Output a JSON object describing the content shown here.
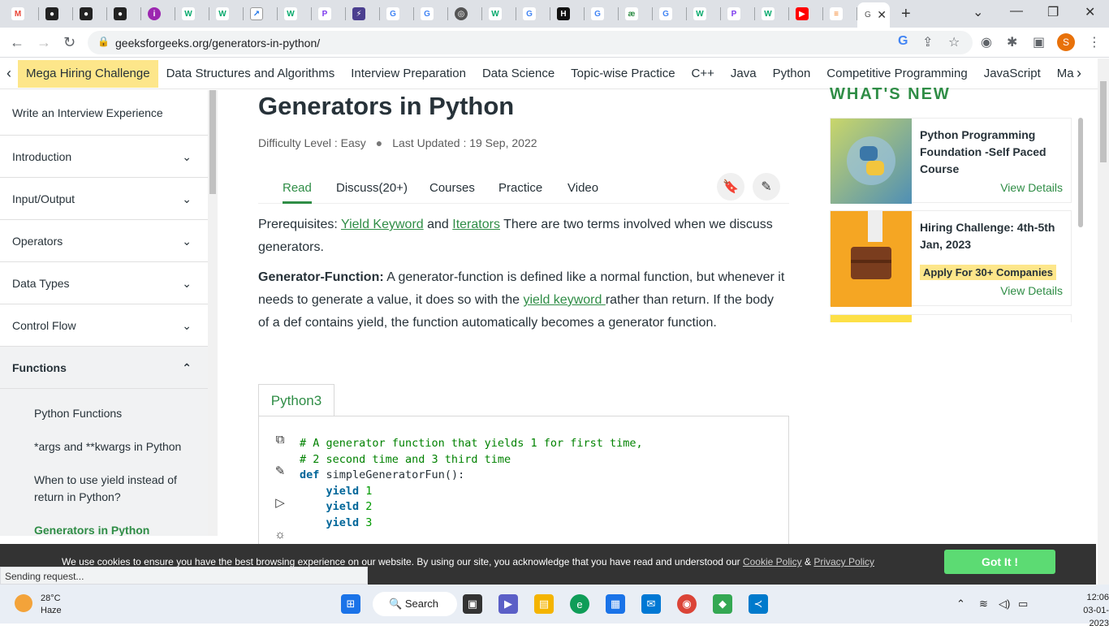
{
  "browser": {
    "active_tab_label": "G",
    "url": "geeksforgeeks.org/generators-in-python/",
    "profile_initial": "S"
  },
  "sitenav": {
    "items": [
      "Mega Hiring Challenge",
      "Data Structures and Algorithms",
      "Interview Preparation",
      "Data Science",
      "Topic-wise Practice",
      "C++",
      "Java",
      "Python",
      "Competitive Programming",
      "JavaScript",
      "Ma"
    ]
  },
  "sidebar": {
    "top_link": "Write an Interview Experience",
    "sections": [
      "Introduction",
      "Input/Output",
      "Operators",
      "Data Types",
      "Control Flow",
      "Functions"
    ],
    "sub_items": [
      "Python Functions",
      "*args and **kwargs in Python",
      "When to use yield instead of return in Python?",
      "Generators in Python"
    ]
  },
  "article": {
    "title": "Generators in Python",
    "difficulty": "Difficulty Level : Easy",
    "updated": "Last Updated : 19 Sep, 2022",
    "tabs": [
      "Read",
      "Discuss(20+)",
      "Courses",
      "Practice",
      "Video"
    ],
    "p1_pre": "Prerequisites: ",
    "p1_link1": "Yield Keyword",
    "p1_and": " and ",
    "p1_link2": "Iterators",
    "p1_post": " There are two terms involved when we discuss generators.",
    "p2_bold": "Generator-Function:",
    "p2_a": " A generator-function is defined like a normal function, but whenever it needs to generate a value, it does so with the ",
    "p2_link": "yield keyword ",
    "p2_b": "rather than return. If the body of a def contains yield, the function automatically becomes a generator function.",
    "code_tab": "Python3",
    "code": {
      "c1": "# A generator function that yields 1 for first time,",
      "c2": "# 2 second time and 3 third time",
      "def_kw": "def",
      "def_rest": " simpleGeneratorFun():",
      "yield_kw": "yield",
      "y1": "1",
      "y2": "2",
      "y3": "3"
    }
  },
  "whats_new": {
    "heading": "WHAT'S NEW",
    "cards": [
      {
        "title": "Python Programming Foundation -Self Paced Course",
        "link": "View Details"
      },
      {
        "title": "Hiring Challenge: 4th-5th Jan, 2023",
        "badge": "Apply For 30+ Companies",
        "link": "View Details"
      }
    ]
  },
  "cookie": {
    "text": "We use cookies to ensure you have the best browsing experience on our website. By using our site, you acknowledge that you have read and understood our ",
    "policy_link": "Cookie Policy",
    "amp": " & ",
    "privacy_link": "Privacy Policy",
    "button": "Got It !"
  },
  "status_bar": "Sending request...",
  "taskbar": {
    "temp": "28°C",
    "weather": "Haze",
    "search": "Search",
    "time": "12:06",
    "date": "03-01-2023"
  }
}
